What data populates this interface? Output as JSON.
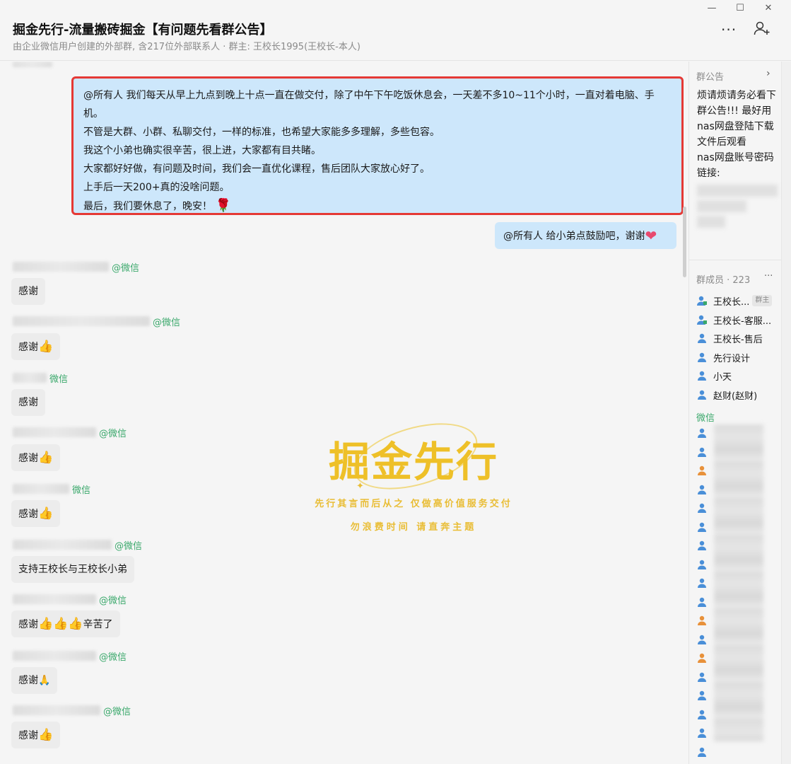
{
  "window": {
    "title": "掘金先行-流量搬砖掘金【有问题先看群公告】",
    "subtitle": "由企业微信用户创建的外部群, 含217位外部联系人 · 群主: 王校长1995(王校长-本人)",
    "controls": {
      "minimize": "—",
      "maximize": "☐",
      "close": "✕"
    },
    "more": "···"
  },
  "announcement": {
    "lines": [
      "@所有人  我们每天从早上九点到晚上十点一直在做交付，除了中午下午吃饭休息会，一天差不多10~11个小时，一直对着电脑、手机。",
      "不管是大群、小群、私聊交付，一样的标准，也希望大家能多多理解，多些包容。",
      "我这个小弟也确实很辛苦，很上进，大家都有目共睹。",
      "大家都好好做，有问题及时间，我们会一直优化课程，售后团队大家放心好了。",
      "上手后一天200+真的没啥问题。",
      "最后，我们要休息了，晚安！"
    ],
    "emoji": "🌹"
  },
  "cheer_message": {
    "text": "@所有人 给小弟点鼓励吧，谢谢",
    "emoji": "❤"
  },
  "tag_wechat": "@微信",
  "tag_wechat_short": "微信",
  "messages": [
    {
      "text": "感谢",
      "thumbs": 0,
      "suffix": ""
    },
    {
      "text": "感谢",
      "thumbs": 1,
      "suffix": ""
    },
    {
      "text": "感谢",
      "thumbs": 0,
      "suffix": ""
    },
    {
      "text": "感谢",
      "thumbs": 1,
      "suffix": ""
    },
    {
      "text": "感谢",
      "thumbs": 1,
      "suffix": ""
    },
    {
      "text": "支持王校长与王校长小弟",
      "thumbs": 0,
      "suffix": ""
    },
    {
      "text": "感谢",
      "thumbs": 3,
      "suffix": "辛苦了"
    },
    {
      "text": "感谢",
      "thumbs": 0,
      "suffix": "🙏"
    },
    {
      "text": "感谢",
      "thumbs": 1,
      "suffix": ""
    }
  ],
  "watermark": {
    "title": "掘金先行",
    "line1": "先行其言而后从之 仅做高价值服务交付",
    "line2": "勿浪费时间 请直奔主题"
  },
  "sidebar": {
    "notice_title": "群公告",
    "notice_text": "烦请烦请务必看下群公告!!! 最好用nas网盘登陆下载文件后观看",
    "notice_text2": "nas网盘账号密码链接:",
    "members_title": "群成员 · 223",
    "members": [
      {
        "name": "王校长...",
        "badge": "群主"
      },
      {
        "name": "王校长-客服...",
        "badge": ""
      },
      {
        "name": "王校长-售后",
        "badge": ""
      },
      {
        "name": "先行设计",
        "badge": ""
      },
      {
        "name": "小天",
        "badge": ""
      },
      {
        "name": "赵财(赵财)",
        "badge": ""
      }
    ],
    "wechat_section": "微信"
  },
  "colors": {
    "accent_blue": "#cde7fb",
    "highlight_red": "#e53935",
    "wechat_green": "#3aa86b",
    "watermark_gold": "#eec028"
  }
}
